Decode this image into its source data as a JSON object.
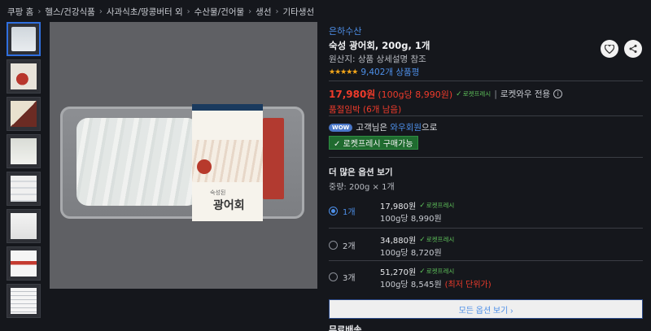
{
  "breadcrumb": [
    "쿠팡 홈",
    "헬스/건강식품",
    "사과식초/땅콩버터 외",
    "수산물/건어물",
    "생선",
    "기타생선"
  ],
  "product": {
    "seller": "은하수산",
    "title": "숙성 광어회, 200g, 1개",
    "origin": "원산지: 상품 상세설명 참조",
    "stars": "★★★★★",
    "review_count": "9,402개 상품평",
    "box_name": "광어회",
    "box_sub": "숙성된"
  },
  "price": {
    "amount": "17,980원",
    "unit": "(100g당 8,990원)",
    "rocket_label": "로켓프레시",
    "wow_only": "로켓와우 전용",
    "stock": "품절임박 (6개 남음)"
  },
  "wow": {
    "badge": "WOW",
    "pre": "고객님은",
    "link": "와우회원",
    "post": "으로",
    "buy_tag": "✓ 로켓프레시 구매가능"
  },
  "options": {
    "title": "더 많은 옵션 보기",
    "subtitle": "중량: 200g × 1개",
    "items": [
      {
        "qty": "1개",
        "price": "17,980원",
        "rocket": "로켓프레시",
        "per": "100g당 8,990원",
        "note": ""
      },
      {
        "qty": "2개",
        "price": "34,880원",
        "rocket": "로켓프레시",
        "per": "100g당 8,720원",
        "note": ""
      },
      {
        "qty": "3개",
        "price": "51,270원",
        "rocket": "로켓프레시",
        "per": "100g당 8,545원",
        "note": "(최저 단위가)"
      }
    ],
    "all_button": "모든 옵션 보기 ›"
  },
  "bottom_partial": "무료배송",
  "icons": {
    "heart": "heart-icon",
    "share": "share-icon",
    "info": "info-icon"
  },
  "colors": {
    "accent": "#4d8fe8",
    "price": "#ee3b2b",
    "rocket": "#5ec25a",
    "background": "#15171c"
  }
}
